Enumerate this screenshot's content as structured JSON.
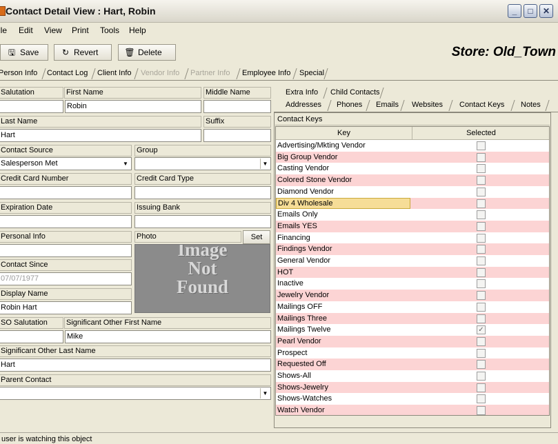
{
  "window": {
    "title": "Contact Detail View : Hart, Robin"
  },
  "menu": [
    "ile",
    "Edit",
    "View",
    "Print",
    "Tools",
    "Help"
  ],
  "toolbar": {
    "save": "Save",
    "revert": "Revert",
    "delete": "Delete",
    "store": "Store: Old_Town"
  },
  "main_tabs": [
    "Person Info",
    "Contact Log",
    "Client Info",
    "Vendor Info",
    "Partner Info",
    "Employee Info",
    "Special"
  ],
  "form": {
    "salutation_label": "Salutation",
    "salutation_value": "",
    "first_name_label": "First Name",
    "first_name_value": "Robin",
    "middle_name_label": "Middle Name",
    "middle_name_value": "",
    "last_name_label": "Last Name",
    "last_name_value": "Hart",
    "suffix_label": "Suffix",
    "suffix_value": "",
    "contact_source_label": "Contact Source",
    "contact_source_value": "Salesperson Met",
    "group_label": "Group",
    "group_value": "",
    "cc_number_label": "Credit Card Number",
    "cc_number_value": "",
    "cc_type_label": "Credit Card Type",
    "cc_type_value": "",
    "expiration_label": "Expiration Date",
    "expiration_value": "",
    "issuing_bank_label": "Issuing Bank",
    "issuing_bank_value": "",
    "personal_info_label": "Personal Info",
    "personal_info_value": "",
    "photo_label": "Photo",
    "set_button": "Set",
    "photo_placeholder": [
      "Image",
      "Not",
      "Found"
    ],
    "contact_since_label": "Contact Since",
    "contact_since_value": "07/07/1977",
    "display_name_label": "Display Name",
    "display_name_value": "Robin Hart",
    "so_salutation_label": "SO Salutation",
    "so_salutation_value": "",
    "so_first_name_label": "Significant Other First Name",
    "so_first_name_value": "Mike",
    "so_last_name_label": "Significant Other Last Name",
    "so_last_name_value": "Hart",
    "parent_contact_label": "Parent Contact",
    "parent_contact_value": ""
  },
  "right_tabs_row1": [
    "Extra Info",
    "Child Contacts"
  ],
  "right_tabs_row2": [
    "Addresses",
    "Phones",
    "Emails",
    "Websites",
    "Contact Keys",
    "Notes"
  ],
  "contact_keys": {
    "header": "Contact Keys",
    "columns": [
      "Key",
      "Selected"
    ],
    "rows": [
      {
        "key": "Advertising/Mkting Vendor",
        "selected": false
      },
      {
        "key": "Big Group Vendor",
        "selected": false
      },
      {
        "key": "Casting Vendor",
        "selected": false
      },
      {
        "key": "Colored Stone Vendor",
        "selected": false
      },
      {
        "key": "Diamond Vendor",
        "selected": false
      },
      {
        "key": "Div 4 Wholesale",
        "selected": false
      },
      {
        "key": "Emails Only",
        "selected": false
      },
      {
        "key": "Emails YES",
        "selected": false
      },
      {
        "key": "Financing",
        "selected": false
      },
      {
        "key": "Findings Vendor",
        "selected": false
      },
      {
        "key": "General Vendor",
        "selected": false
      },
      {
        "key": "HOT",
        "selected": false
      },
      {
        "key": "Inactive",
        "selected": false
      },
      {
        "key": "Jewelry Vendor",
        "selected": false
      },
      {
        "key": "Mailings OFF",
        "selected": false
      },
      {
        "key": "Mailings Three",
        "selected": false
      },
      {
        "key": "Mailings Twelve",
        "selected": true
      },
      {
        "key": "Pearl Vendor",
        "selected": false
      },
      {
        "key": "Prospect",
        "selected": false
      },
      {
        "key": "Requested Off",
        "selected": false
      },
      {
        "key": "Shows-All",
        "selected": false
      },
      {
        "key": "Shows-Jewelry",
        "selected": false
      },
      {
        "key": "Shows-Watches",
        "selected": false
      },
      {
        "key": "Watch Vendor",
        "selected": false
      }
    ]
  },
  "status": "user is watching this object",
  "colors": {
    "row_alt": "#fcd4d4",
    "row_selected": "#f6dd97",
    "photo_bg": "#8b8b8b"
  }
}
